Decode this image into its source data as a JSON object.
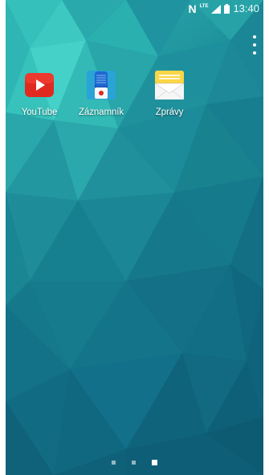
{
  "status_bar": {
    "nfc_glyph": "N",
    "network_label": "LTE",
    "time": "13:40"
  },
  "home_screen": {
    "apps": [
      {
        "label": "YouTube",
        "icon": "youtube-icon",
        "color": "#e02a20"
      },
      {
        "label": "Záznamník",
        "icon": "voice-recorder-icon",
        "color": "#1a78d4"
      },
      {
        "label": "Zprávy",
        "icon": "messages-icon",
        "color": "#f7c41e"
      }
    ],
    "menu_icon": "overflow-menu-icon",
    "pages": {
      "count": 3,
      "active_index": 2
    }
  },
  "colors": {
    "wallpaper_base": "#1f8d97",
    "wallpaper_light": "#3fc7c3",
    "wallpaper_dark": "#0e5a6e"
  }
}
